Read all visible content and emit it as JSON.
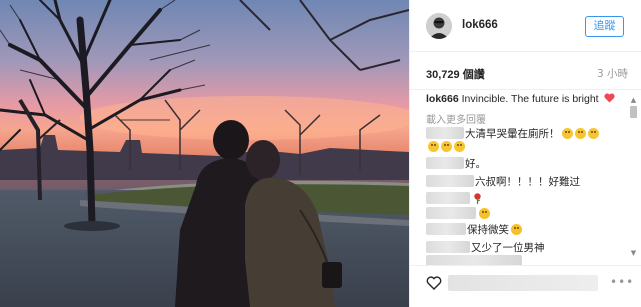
{
  "post": {
    "username": "lok666",
    "follow_label": "追蹤",
    "likes": "30,729 個讚",
    "time": "3 小時",
    "caption_user": "lok666",
    "caption_text": "Invincible. The future is bright",
    "load_more": "載入更多回覆"
  },
  "comments": [
    {
      "text": "大清早哭暈在廁所！",
      "emoji": [
        "crying-emoji",
        "crying-emoji",
        "crying-emoji"
      ]
    },
    {
      "text": "",
      "emoji": [
        "crying-emoji",
        "crying-emoji",
        "crying-emoji"
      ]
    },
    {
      "text": "好。",
      "emoji": []
    },
    {
      "text": "六叔啊！！！！好難过",
      "emoji": []
    },
    {
      "text": "",
      "emoji": [
        "rose-emoji"
      ]
    },
    {
      "text": "",
      "emoji": [
        "smile-emoji"
      ]
    },
    {
      "text": "保持微笑",
      "emoji": [
        "smile-emoji"
      ]
    },
    {
      "text": "又少了一位男神",
      "emoji": []
    }
  ],
  "icons": {
    "heart": "heart-icon",
    "like": "like-outline-icon",
    "more": "more-dots-icon"
  },
  "colors": {
    "accent": "#3897f0",
    "heart": "#ed4956"
  }
}
